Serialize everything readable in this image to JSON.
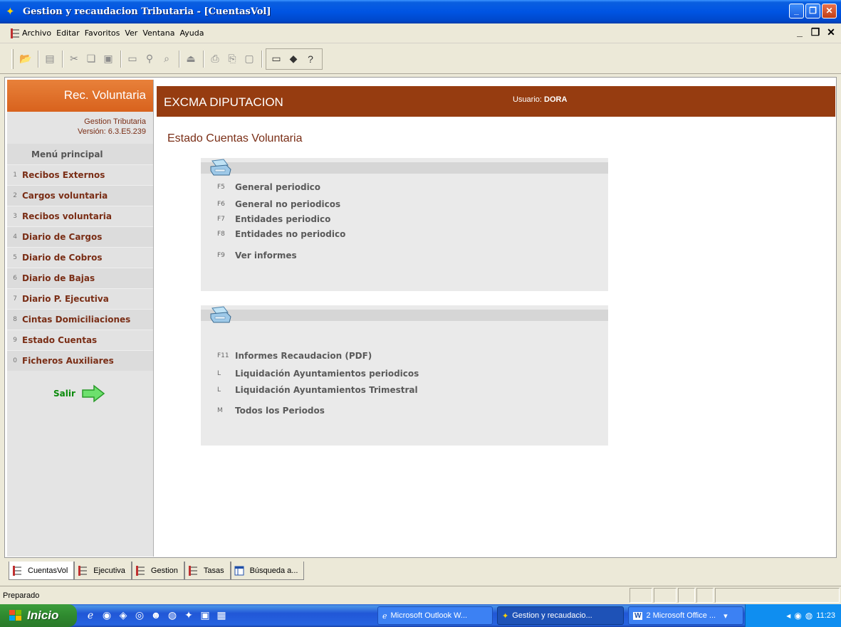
{
  "window": {
    "title": "Gestion y recaudacion Tributaria - [CuentasVol]"
  },
  "menu": {
    "items": [
      "Archivo",
      "Editar",
      "Favoritos",
      "Ver",
      "Ventana",
      "Ayuda"
    ]
  },
  "sidebar": {
    "header": "Rec. Voluntaria",
    "app_name": "Gestion Tributaria",
    "version": "Versión: 6.3.E5.239",
    "menu_title": "Menú principal",
    "items": [
      {
        "num": "1",
        "label": "Recibos Externos"
      },
      {
        "num": "2",
        "label": "Cargos voluntaria"
      },
      {
        "num": "3",
        "label": "Recibos voluntaria"
      },
      {
        "num": "4",
        "label": "Diario de Cargos"
      },
      {
        "num": "5",
        "label": "Diario de Cobros"
      },
      {
        "num": "6",
        "label": "Diario de Bajas"
      },
      {
        "num": "7",
        "label": "Diario P. Ejecutiva"
      },
      {
        "num": "8",
        "label": "Cintas Domiciliaciones"
      },
      {
        "num": "9",
        "label": "Estado Cuentas"
      },
      {
        "num": "0",
        "label": "Ficheros Auxiliares"
      }
    ],
    "exit_label": "Salir"
  },
  "header": {
    "organization": "EXCMA DIPUTACION",
    "user_prefix": "Usuario:",
    "user_name": "DORA"
  },
  "page": {
    "title": "Estado Cuentas Voluntaria"
  },
  "panel1": {
    "rows": [
      {
        "key": "F5",
        "label": "General periodico"
      },
      {
        "key": "F6",
        "label": "General no periodicos"
      },
      {
        "key": "F7",
        "label": "Entidades periodico"
      },
      {
        "key": "F8",
        "label": "Entidades no periodico"
      },
      {
        "key": "F9",
        "label": "Ver informes"
      }
    ]
  },
  "panel2": {
    "rows": [
      {
        "key": "F11",
        "label": "Informes Recaudacion (PDF)"
      },
      {
        "key": "L",
        "label": "Liquidación Ayuntamientos periodicos"
      },
      {
        "key": "L",
        "label": "Liquidación Ayuntamientos Trimestral"
      },
      {
        "key": "M",
        "label": "Todos los Periodos"
      }
    ]
  },
  "mdi_tabs": [
    "CuentasVol",
    "Ejecutiva",
    "Gestion",
    "Tasas",
    "Búsqueda a..."
  ],
  "status": {
    "text": "Preparado"
  },
  "taskbar": {
    "start_label": "Inicio",
    "tasks": [
      "Microsoft Outlook W...",
      "Gestion y recaudacio...",
      "2 Microsoft Office ..."
    ],
    "clock": "11:23"
  },
  "colors": {
    "accent": "#963c10",
    "sidebar_header": "#e06a25",
    "text_brown": "#7a2e16"
  }
}
